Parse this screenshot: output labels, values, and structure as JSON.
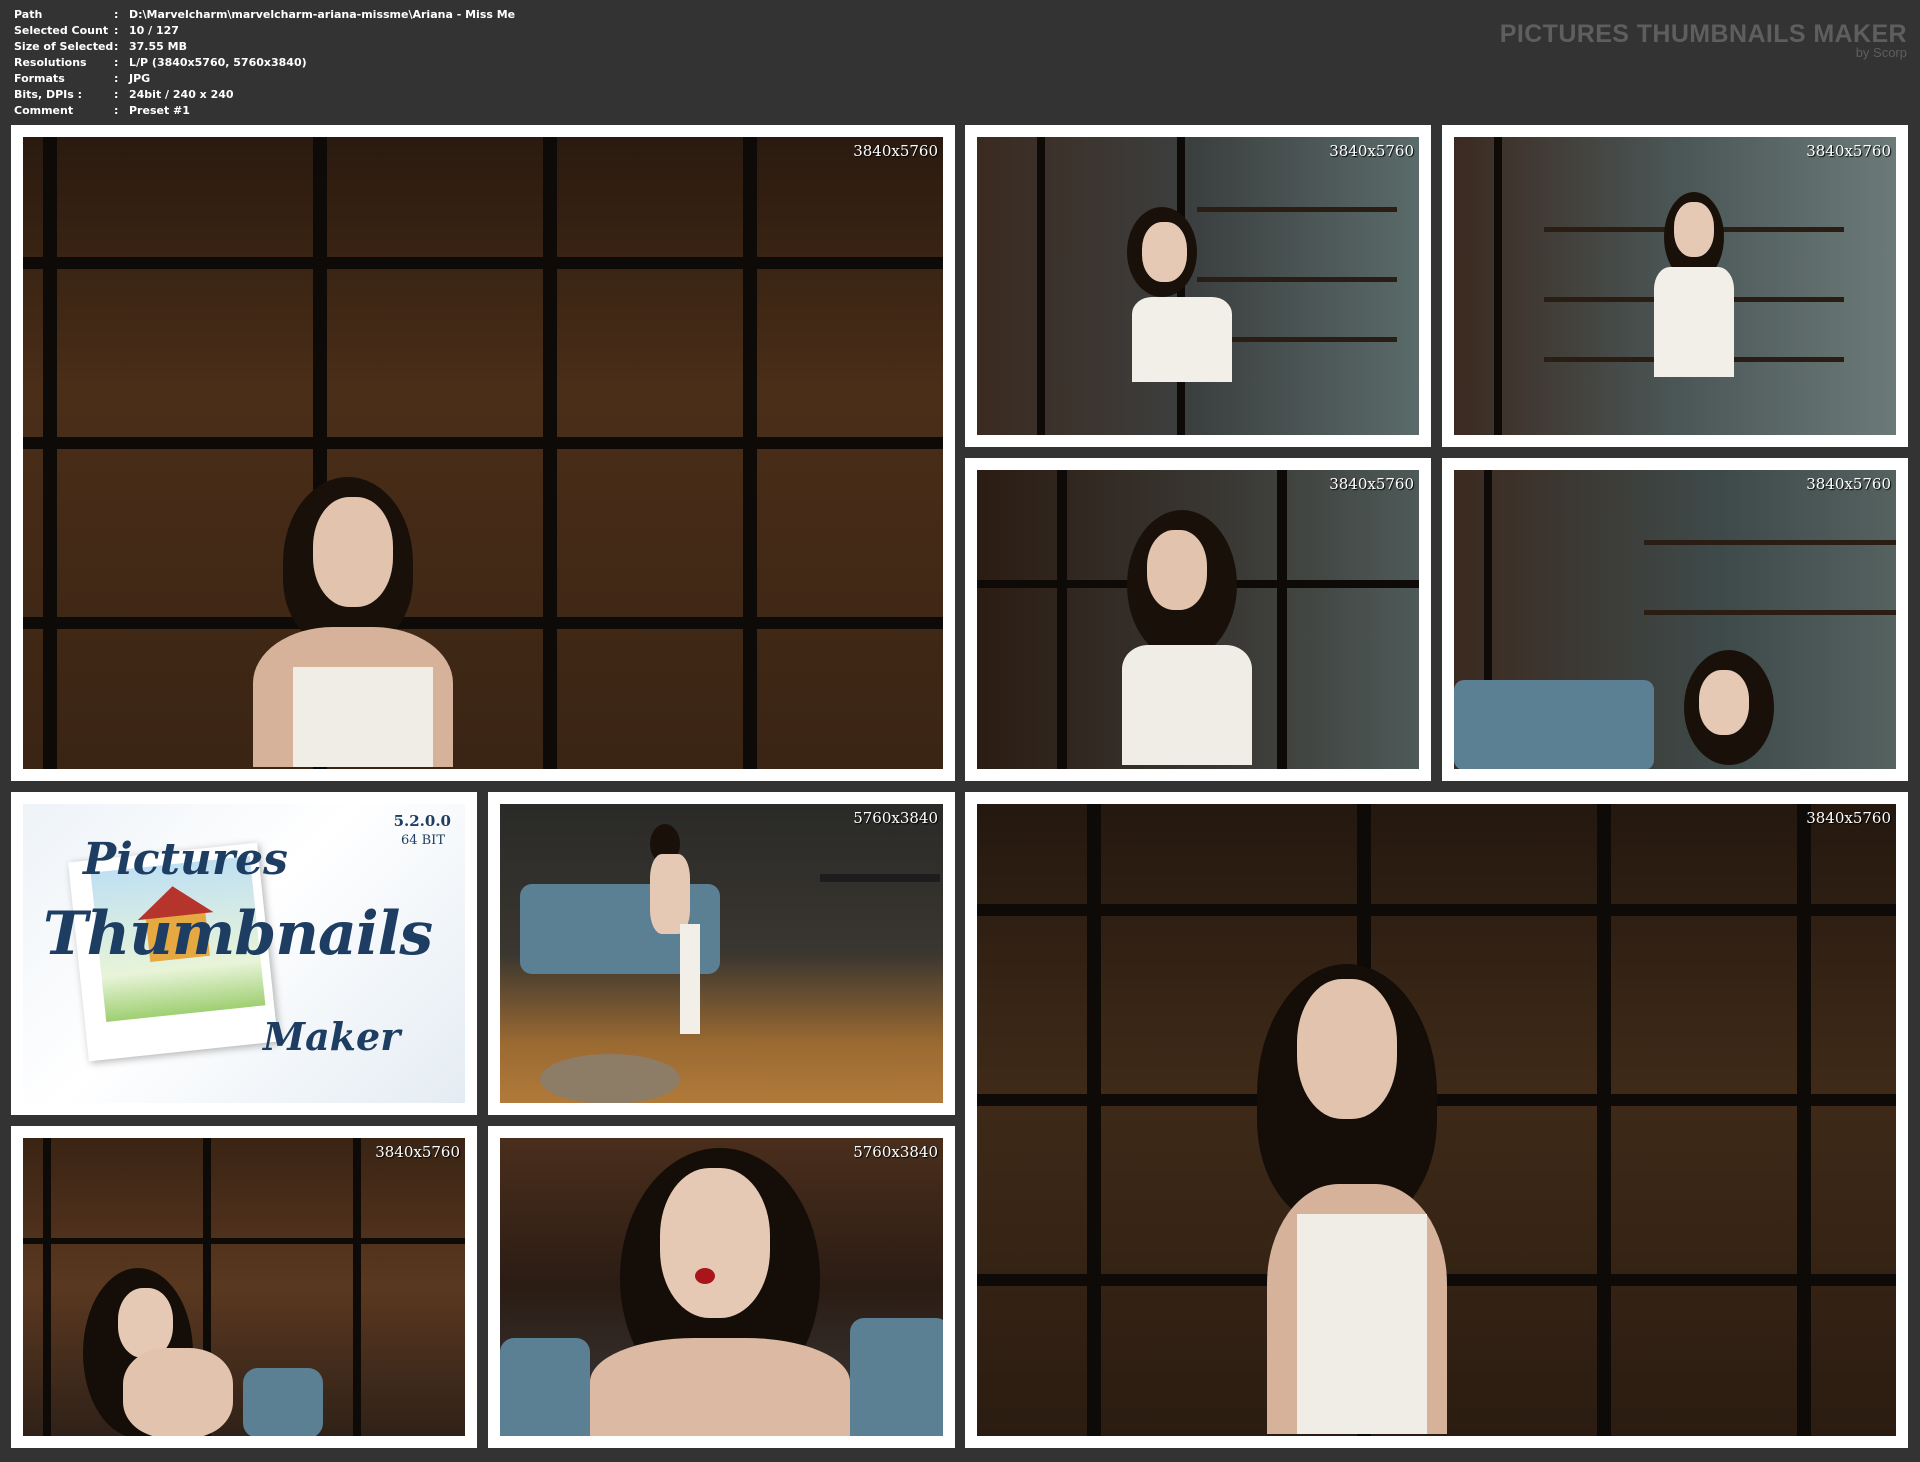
{
  "info": {
    "sep": ":",
    "rows": [
      {
        "key": "Path",
        "value": "D:\\Marvelcharm\\marvelcharm-ariana-missme\\Ariana - Miss Me"
      },
      {
        "key": "Selected Count",
        "value": "10 / 127"
      },
      {
        "key": "Size of Selected",
        "value": "37.55 MB"
      },
      {
        "key": "Resolutions",
        "value": "L/P (3840x5760, 5760x3840)"
      },
      {
        "key": "Formats",
        "value": "JPG"
      },
      {
        "key": "Bits, DPIs :",
        "value": "24bit / 240 x 240"
      },
      {
        "key": "Comment",
        "value": "Preset #1"
      }
    ]
  },
  "brand": {
    "title": "PICTURES THUMBNAILS MAKER",
    "subtitle": "by Scorp"
  },
  "thumbs": [
    {
      "res": "3840x5760"
    },
    {
      "res": "3840x5760"
    },
    {
      "res": "3840x5760"
    },
    {
      "res": "3840x5760"
    },
    {
      "res": "3840x5760"
    },
    {
      "res": "5760x3840"
    },
    {
      "res": "3840x5760"
    },
    {
      "res": "3840x5760"
    },
    {
      "res": "5760x3840"
    }
  ],
  "logo": {
    "version": "5.2.0.0",
    "bits": "64 BIT",
    "word1": "Pictures",
    "word2": "Thumbnails",
    "word3": "Maker"
  },
  "colors": {
    "background": "#333333",
    "frame": "#ffffff",
    "logo_text": "#1d3d62"
  }
}
